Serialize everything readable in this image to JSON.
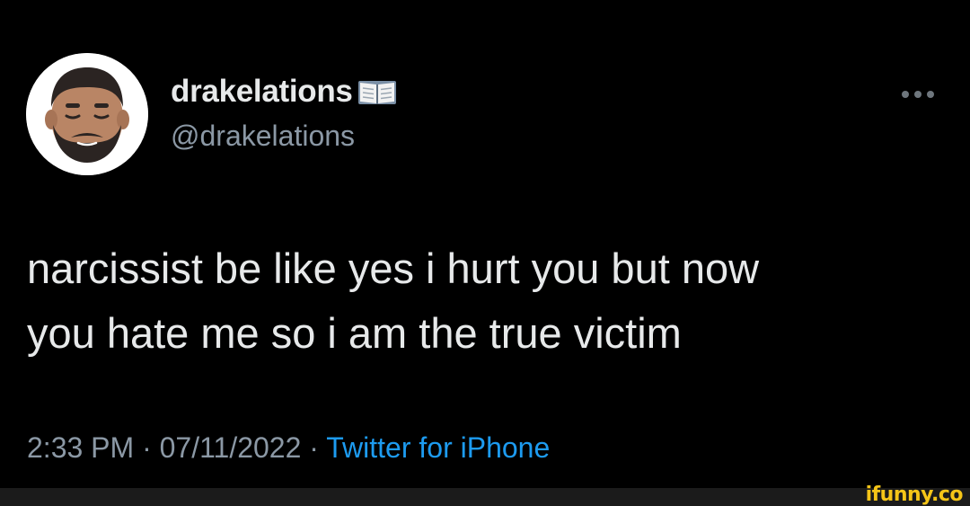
{
  "tweet": {
    "display_name": "drakelations",
    "name_badge_icon": "open-book-icon",
    "handle": "@drakelations",
    "more_icon": "more-horizontal-icon",
    "text": "narcissist be like yes i hurt you but now\nyou hate me so i am the true victim",
    "time": "2:33 PM",
    "separator": "·",
    "date": "07/11/2022",
    "source": "Twitter for iPhone"
  },
  "watermark": {
    "text": "ifunny.co"
  },
  "colors": {
    "background": "#000000",
    "primary_text": "#e7e9ea",
    "secondary_text": "#8b98a5",
    "link": "#1d9bf0",
    "watermark": "#f5c518"
  }
}
